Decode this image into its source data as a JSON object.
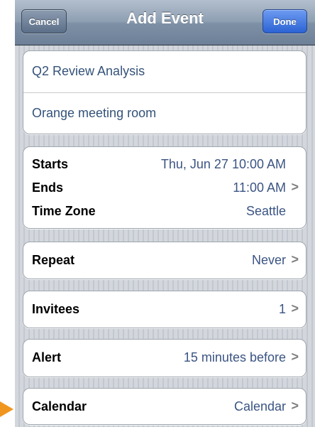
{
  "navbar": {
    "title": "Add Event",
    "cancel_label": "Cancel",
    "done_label": "Done"
  },
  "event": {
    "title": "Q2 Review Analysis",
    "location": "Orange meeting room"
  },
  "time": {
    "starts_label": "Starts",
    "starts_value": "Thu, Jun 27  10:00 AM",
    "ends_label": "Ends",
    "ends_value": "11:00 AM",
    "timezone_label": "Time Zone",
    "timezone_value": "Seattle"
  },
  "rows": {
    "repeat": {
      "label": "Repeat",
      "value": "Never"
    },
    "invitees": {
      "label": "Invitees",
      "value": "1"
    },
    "alert": {
      "label": "Alert",
      "value": "15 minutes before"
    },
    "calendar": {
      "label": "Calendar",
      "value": "Calendar"
    }
  },
  "chevron_glyph": ">",
  "colors": {
    "value_text": "#3b5483",
    "done_button": "#2c63d4",
    "pointer": "#f0961e"
  },
  "icons": [
    "chevron-right-icon",
    "pointer-arrow-icon"
  ]
}
